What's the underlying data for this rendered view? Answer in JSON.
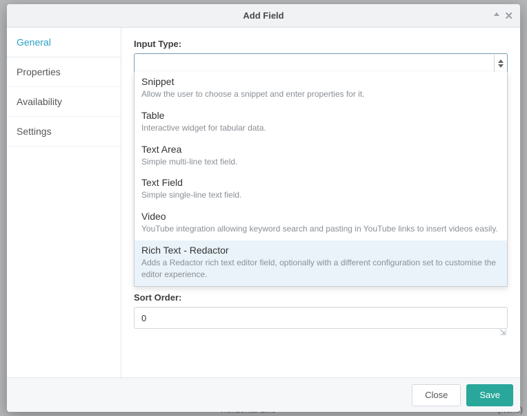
{
  "header": {
    "title": "Add Field"
  },
  "sidebar": {
    "items": [
      {
        "label": "General"
      },
      {
        "label": "Properties"
      },
      {
        "label": "Availability"
      },
      {
        "label": "Settings"
      }
    ]
  },
  "form": {
    "input_type_label": "Input Type:",
    "input_type_value": "",
    "options": [
      {
        "title": "Snippet",
        "desc": "Allow the user to choose a snippet and enter properties for it."
      },
      {
        "title": "Table",
        "desc": "Interactive widget for tabular data."
      },
      {
        "title": "Text Area",
        "desc": "Simple multi-line text field."
      },
      {
        "title": "Text Field",
        "desc": "Simple single-line text field."
      },
      {
        "title": "Video",
        "desc": "YouTube integration allowing keyword search and pasting in YouTube links to insert videos easily."
      },
      {
        "title": "Rich Text - Redactor",
        "desc": "Adds a Redactor rich text editor field, optionally with a different configuration set to customise the editor experience."
      }
    ],
    "sort_order_label": "Sort Order:",
    "sort_order_value": "0"
  },
  "footer": {
    "close_label": "Close",
    "save_label": "Save"
  },
  "bg": {
    "line1": "Horizontal Line",
    "none": "(None)"
  }
}
